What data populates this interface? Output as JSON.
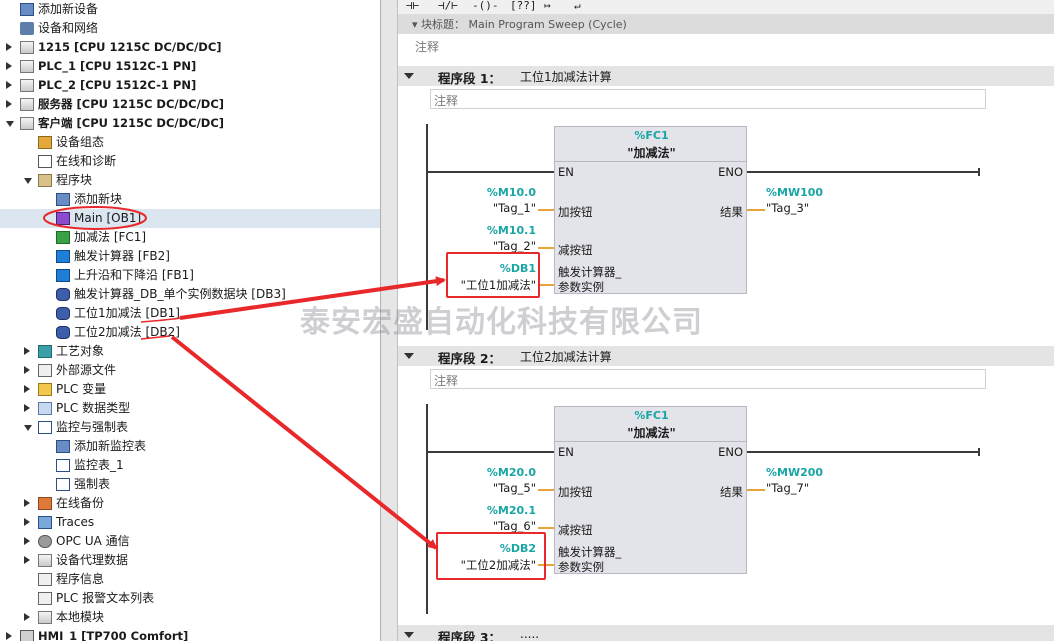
{
  "tree": {
    "items": [
      {
        "label": "添加新设备",
        "icon": "add-device-icon"
      },
      {
        "label": "设备和网络",
        "icon": "devices-networks-icon"
      },
      {
        "label": "1215 [CPU 1215C DC/DC/DC]",
        "icon": "cpu-icon"
      },
      {
        "label": "PLC_1 [CPU 1512C-1 PN]",
        "icon": "cpu-icon"
      },
      {
        "label": "PLC_2 [CPU 1512C-1 PN]",
        "icon": "cpu-icon"
      },
      {
        "label": "服务器 [CPU 1215C DC/DC/DC]",
        "icon": "cpu-icon"
      },
      {
        "label": "客户端 [CPU 1215C DC/DC/DC]",
        "icon": "cpu-icon"
      },
      {
        "label": "设备组态",
        "icon": "device-config-icon"
      },
      {
        "label": "在线和诊断",
        "icon": "online-diagnostics-icon"
      },
      {
        "label": "程序块",
        "icon": "folder-icon"
      },
      {
        "label": "添加新块",
        "icon": "add-block-icon"
      },
      {
        "label": "Main [OB1]",
        "icon": "ob-icon"
      },
      {
        "label": "加减法 [FC1]",
        "icon": "fc-icon"
      },
      {
        "label": "触发计算器 [FB2]",
        "icon": "fb-icon"
      },
      {
        "label": "上升沿和下降沿 [FB1]",
        "icon": "fb-icon"
      },
      {
        "label": "触发计算器_DB_单个实例数据块 [DB3]",
        "icon": "db-icon"
      },
      {
        "label": "工位1加减法 [DB1]",
        "icon": "db-icon"
      },
      {
        "label": "工位2加减法 [DB2]",
        "icon": "db-icon"
      },
      {
        "label": "工艺对象",
        "icon": "technology-objects-icon"
      },
      {
        "label": "外部源文件",
        "icon": "external-source-icon"
      },
      {
        "label": "PLC 变量",
        "icon": "plc-tags-icon"
      },
      {
        "label": "PLC 数据类型",
        "icon": "plc-data-types-icon"
      },
      {
        "label": "监控与强制表",
        "icon": "watch-force-icon"
      },
      {
        "label": "添加新监控表",
        "icon": "add-watch-table-icon"
      },
      {
        "label": "监控表_1",
        "icon": "watch-table-icon"
      },
      {
        "label": "强制表",
        "icon": "force-table-icon"
      },
      {
        "label": "在线备份",
        "icon": "online-backup-icon"
      },
      {
        "label": "Traces",
        "icon": "traces-icon"
      },
      {
        "label": "OPC UA 通信",
        "icon": "opc-ua-icon"
      },
      {
        "label": "设备代理数据",
        "icon": "device-proxy-icon"
      },
      {
        "label": "程序信息",
        "icon": "program-info-icon"
      },
      {
        "label": "PLC 报警文本列表",
        "icon": "alarm-text-icon"
      },
      {
        "label": "本地模块",
        "icon": "local-modules-icon"
      },
      {
        "label": "HMI_1 [TP700 Comfort]",
        "icon": "hmi-icon"
      }
    ]
  },
  "editor": {
    "block_title_cut": "▾ 块标题：   Main Program Sweep (Cycle)",
    "block_comment": "注释",
    "segments": [
      {
        "title": "程序段 1：",
        "name": "工位1加减法计算",
        "comment": "注释",
        "fc_addr": "%FC1",
        "fc_name": "\"加减法\"",
        "pins": {
          "en": "EN",
          "eno": "ENO",
          "in1": "加按钮",
          "in2": "减按钮",
          "out": "结果",
          "inst1": "触发计算器_",
          "inst2": "参数实例"
        },
        "in1_addr": "%M10.0",
        "in1_tag": "\"Tag_1\"",
        "in2_addr": "%M10.1",
        "in2_tag": "\"Tag_2\"",
        "db_addr": "%DB1",
        "db_name": "\"工位1加减法\"",
        "out_addr": "%MW100",
        "out_tag": "\"Tag_3\""
      },
      {
        "title": "程序段 2：",
        "name": "工位2加减法计算",
        "comment": "注释",
        "fc_addr": "%FC1",
        "fc_name": "\"加减法\"",
        "pins": {
          "en": "EN",
          "eno": "ENO",
          "in1": "加按钮",
          "in2": "减按钮",
          "out": "结果",
          "inst1": "触发计算器_",
          "inst2": "参数实例"
        },
        "in1_addr": "%M20.0",
        "in1_tag": "\"Tag_5\"",
        "in2_addr": "%M20.1",
        "in2_tag": "\"Tag_6\"",
        "db_addr": "%DB2",
        "db_name": "\"工位2加减法\"",
        "out_addr": "%MW200",
        "out_tag": "\"Tag_7\""
      },
      {
        "title": "程序段 3：",
        "name": "....."
      }
    ]
  },
  "watermark": "泰安宏盛自动化科技有限公司",
  "colors": {
    "annotation": "#e8282a",
    "address": "#1aa5a5",
    "wire_highlight": "#e8a33a"
  }
}
